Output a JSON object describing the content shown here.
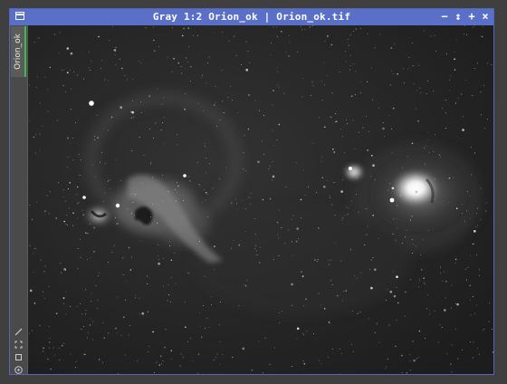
{
  "window": {
    "title": "Gray 1:2 Orion_ok | Orion_ok.tif",
    "controls": {
      "minimize": "−",
      "shade": "↕",
      "maximize": "+",
      "close": "×"
    }
  },
  "sidebar": {
    "tab_label": "Orion_ok",
    "tools": [
      "pencil-icon",
      "expand-icon",
      "contract-icon",
      "target-icon"
    ]
  },
  "image": {
    "description": ""
  }
}
